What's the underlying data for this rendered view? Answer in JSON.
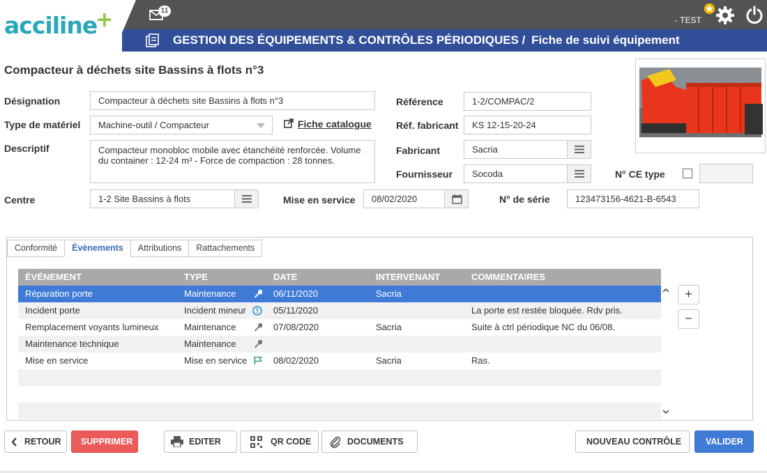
{
  "app": {
    "logo_text": "acciline",
    "logo_plus": "+",
    "user": "- TEST",
    "mail_count": "11"
  },
  "header": {
    "breadcrumb_main": "GESTION DES ÉQUIPEMENTS & CONTRÔLES PÉRIODIQUES /",
    "breadcrumb_sub": "Fiche de suivi équipement"
  },
  "page": {
    "title": "Compacteur à déchets site Bassins à flots n°3"
  },
  "form": {
    "designation_label": "Désignation",
    "designation_value": "Compacteur à déchets site Bassins à flots n°3",
    "type_label": "Type de matériel",
    "type_value": "Machine-outil / Compacteur",
    "catalogue_link": "Fiche catalogue",
    "descriptif_label": "Descriptif",
    "descriptif_value": "Compacteur monobloc mobile avec étanchéité renforcée. Volume du container : 12-24 m³ - Force de compaction : 28 tonnes.",
    "centre_label": "Centre",
    "centre_value": "1-2 Site Bassins à flots",
    "mise_service_label": "Mise en service",
    "mise_service_value": "08/02/2020",
    "reference_label": "Référence",
    "reference_value": "1-2/COMPAC/2",
    "ref_fabricant_label": "Réf. fabricant",
    "ref_fabricant_value": "KS 12-15-20-24",
    "fabricant_label": "Fabricant",
    "fabricant_value": "Sacria",
    "fournisseur_label": "Fournisseur",
    "fournisseur_value": "Socoda",
    "ce_type_label": "N° CE type",
    "ce_type_value": "",
    "serie_label": "N° de série",
    "serie_value": "123473156-4621-B-6543"
  },
  "tabs": [
    {
      "label": "Conformité"
    },
    {
      "label": "Évènements"
    },
    {
      "label": "Attributions"
    },
    {
      "label": "Rattachements"
    }
  ],
  "grid": {
    "columns": [
      "ÉVÉNEMENT",
      "TYPE",
      "DATE",
      "INTERVENANT",
      "COMMENTAIRES"
    ],
    "rows": [
      {
        "event": "Réparation porte",
        "type": "Maintenance",
        "icon": "wrench-icon",
        "date": "06/11/2020",
        "intervenant": "Sacria",
        "comment": ""
      },
      {
        "event": "Incident porte",
        "type": "Incident mineur",
        "icon": "alert-circle-icon",
        "date": "05/11/2020",
        "intervenant": "",
        "comment": "La porte est restée bloquée. Rdv pris."
      },
      {
        "event": "Remplacement voyants lumineux",
        "type": "Maintenance",
        "icon": "wrench-icon",
        "date": "07/08/2020",
        "intervenant": "Sacria",
        "comment": "Suite à ctrl périodique NC du 06/08."
      },
      {
        "event": "Maintenance technique",
        "type": "Maintenance",
        "icon": "wrench-icon",
        "date": "",
        "intervenant": "",
        "comment": ""
      },
      {
        "event": "Mise en service",
        "type": "Mise en service",
        "icon": "flag-icon",
        "date": "08/02/2020",
        "intervenant": "Sacria",
        "comment": "Ras."
      }
    ]
  },
  "actions": {
    "retour": "RETOUR",
    "supprimer": "SUPPRIMER",
    "editer": "EDITER",
    "qr": "QR CODE",
    "documents": "DOCUMENTS",
    "nouveau": "NOUVEAU CONTRÔLE",
    "valider": "VALIDER",
    "plus": "+",
    "minus": "−"
  },
  "colors": {
    "header_dark": "#545454",
    "header_blue": "#314f98",
    "selection": "#3f7ad6",
    "danger": "#ed5a5a",
    "accent_teal": "#2aa8b8",
    "accent_green": "#8dc63f"
  }
}
